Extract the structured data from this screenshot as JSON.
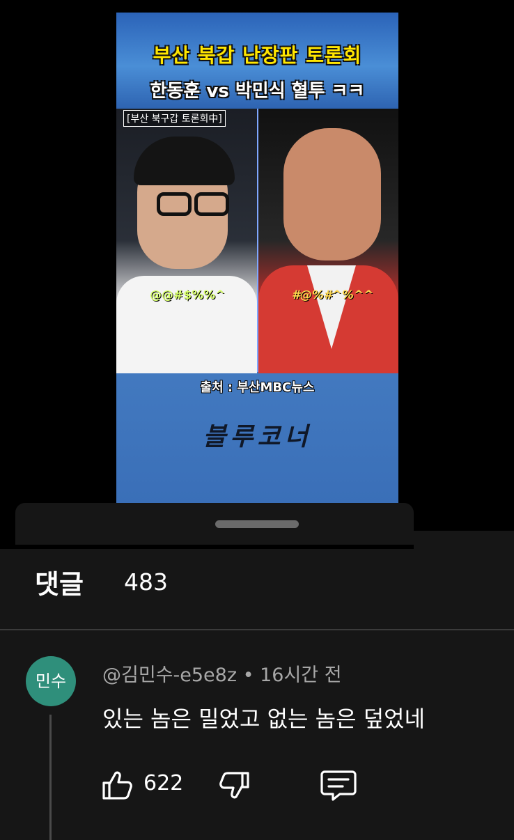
{
  "video": {
    "title_line1": "부산 북갑 난장판 토론회",
    "title_line2": "한동훈 vs 박민식 혈투 ㅋㅋ",
    "caption_tag": "[부산 북구갑 토론회中]",
    "cursing_left": "@@#$%%^",
    "cursing_right": "#@%#^%^^",
    "source": "출처 : 부산MBC뉴스",
    "brand": "블루코너"
  },
  "comments": {
    "title": "댓글",
    "count": "483"
  },
  "comment": {
    "avatar_text": "민수",
    "meta": "@김민수-e5e8z • 16시간 전",
    "text": "있는 놈은 밀었고 없는 놈은 덮었네",
    "likes": "622"
  },
  "colors": {
    "background": "#000000",
    "sheet": "#161616",
    "avatar": "#2f8f7b",
    "muted_text": "#a8a8a8"
  }
}
